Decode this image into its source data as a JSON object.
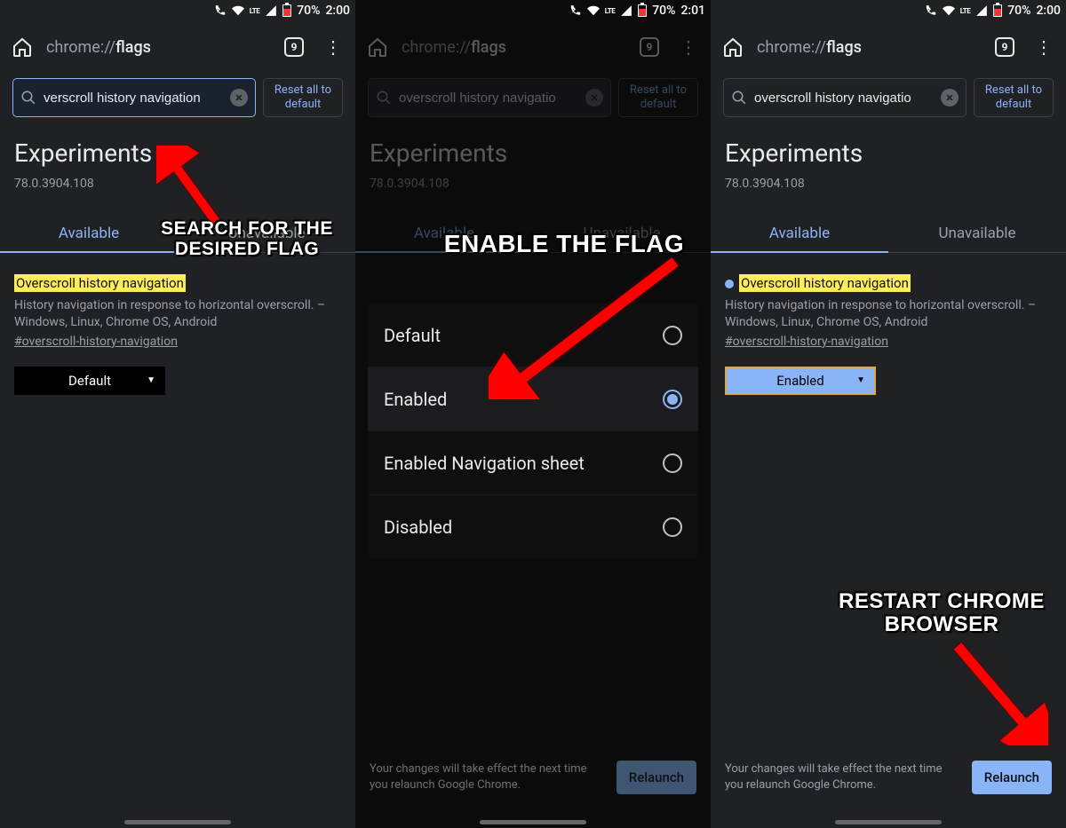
{
  "status_bar": {
    "battery": "70%",
    "time_a": "2:00",
    "time_b": "2:01",
    "time_c": "2:00",
    "net": "LTE"
  },
  "omni": {
    "prefix": "chrome://",
    "bold_part": "flags",
    "tab_count": "9"
  },
  "search": {
    "value_a": "verscroll history navigation",
    "value_bc": "overscroll history navigatio"
  },
  "reset_label": "Reset all to default",
  "experiments_label": "Experiments",
  "version": "78.0.3904.108",
  "tabs": {
    "available": "Available",
    "unavailable": "Unavailable"
  },
  "flag": {
    "title": "Overscroll history navigation",
    "description": "History navigation in response to horizontal overscroll. – Windows, Linux, Chrome OS, Android",
    "hash": "#overscroll-history-navigation"
  },
  "dropdown": {
    "default_label": "Default",
    "enabled_label": "Enabled"
  },
  "options": [
    "Default",
    "Enabled",
    "Enabled Navigation sheet",
    "Disabled"
  ],
  "footer": {
    "note": "Your changes will take effect the next time you relaunch Google Chrome.",
    "relaunch": "Relaunch"
  },
  "captions": {
    "a": "SEARCH FOR THE DESIRED FLAG",
    "b": "ENABLE THE FLAG",
    "c": "RESTART CHROME BROWSER"
  }
}
